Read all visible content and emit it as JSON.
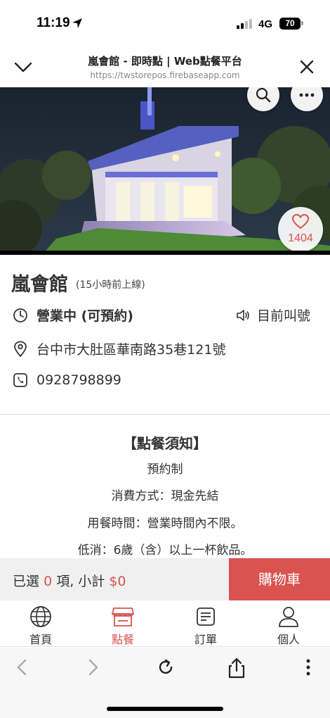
{
  "status_bar": {
    "time": "11:19",
    "network": "4G",
    "battery": "70"
  },
  "browser_header": {
    "title": "嵐會館 - 即時點 | Web點餐平台",
    "url": "https://twstorepos.firebaseapp.com"
  },
  "hero": {
    "like_count": "1404"
  },
  "store": {
    "name": "嵐會館",
    "online_status": "(15小時前上線)",
    "business_status": "營業中 (可預約)",
    "call_number_label": "目前叫號",
    "address": "台中市大肚區華南路35巷121號",
    "phone": "0928798899"
  },
  "notice": {
    "title": "【點餐須知】",
    "lines": [
      "預約制",
      "消費方式：現金先結",
      "用餐時間：營業時間內不限。",
      "低消：6歲（含）以上一杯飲品。"
    ]
  },
  "cart": {
    "prefix": "已選",
    "count": "0",
    "middle": "項, 小計",
    "total": "$0",
    "button_label": "購物車"
  },
  "tabs": [
    {
      "label": "首頁",
      "icon": "globe-icon"
    },
    {
      "label": "點餐",
      "icon": "store-icon"
    },
    {
      "label": "訂單",
      "icon": "receipt-icon"
    },
    {
      "label": "個人",
      "icon": "person-icon"
    }
  ],
  "colors": {
    "accent": "#d9534f",
    "text": "#333333"
  }
}
